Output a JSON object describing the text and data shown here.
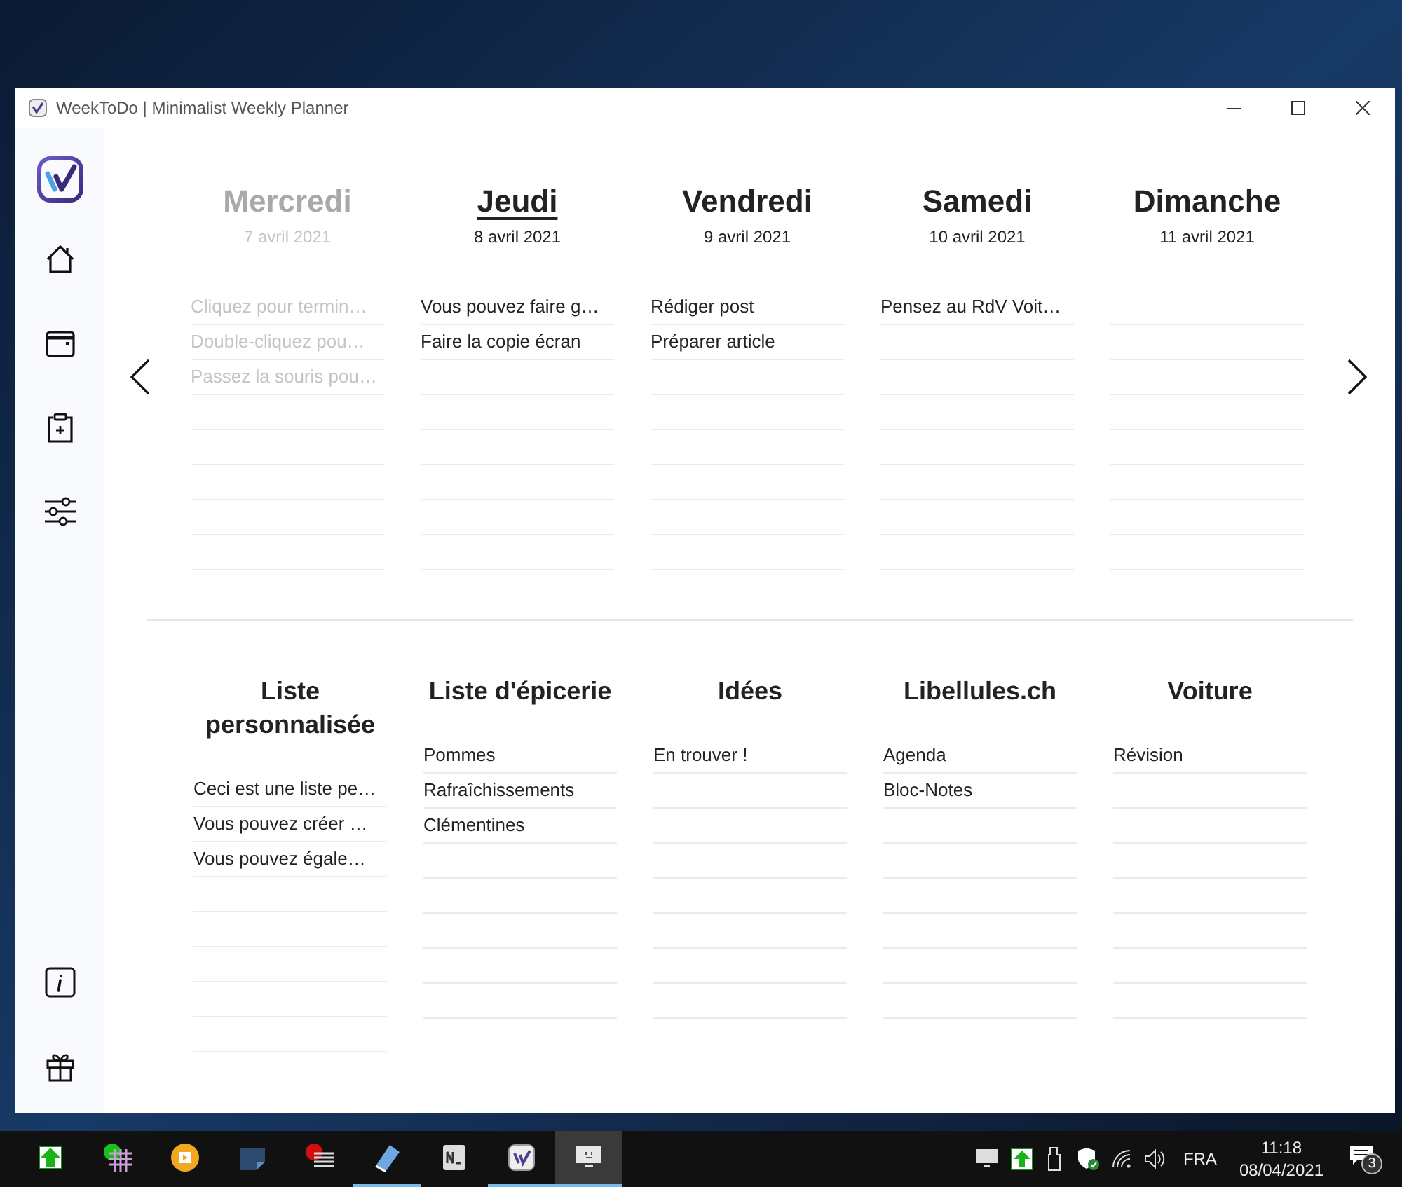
{
  "window": {
    "title": "WeekToDo | Minimalist Weekly Planner"
  },
  "days": [
    {
      "name": "Mercredi",
      "date": "7 avril 2021",
      "past": true,
      "today": false,
      "tasks": [
        "Cliquez pour termin…",
        "Double-cliquez pou…",
        "Passez la souris pou…"
      ]
    },
    {
      "name": "Jeudi",
      "date": "8 avril 2021",
      "past": false,
      "today": true,
      "tasks": [
        "Vous pouvez faire g…",
        "Faire la copie écran"
      ]
    },
    {
      "name": "Vendredi",
      "date": "9 avril 2021",
      "past": false,
      "today": false,
      "tasks": [
        "Rédiger post",
        "Préparer article"
      ]
    },
    {
      "name": "Samedi",
      "date": "10 avril 2021",
      "past": false,
      "today": false,
      "tasks": [
        "Pensez au RdV Voit…"
      ]
    },
    {
      "name": "Dimanche",
      "date": "11 avril 2021",
      "past": false,
      "today": false
    }
  ],
  "lists": [
    {
      "name": "Liste personnalisée",
      "tasks": [
        "Ceci est une liste pe…",
        "Vous pouvez créer …",
        "Vous pouvez égale…"
      ]
    },
    {
      "name": "Liste d'épicerie",
      "tasks": [
        "Pommes",
        "Rafraîchissements",
        "Clémentines"
      ]
    },
    {
      "name": "Idées",
      "tasks": [
        "En trouver !"
      ]
    },
    {
      "name": "Libellules.ch",
      "tasks": [
        "Agenda",
        "Bloc-Notes"
      ]
    },
    {
      "name": "Voiture",
      "tasks": [
        "Révision"
      ]
    }
  ],
  "taskbar": {
    "apps": [
      {
        "kind": "upload",
        "running": false,
        "active": false
      },
      {
        "kind": "grid",
        "running": false,
        "active": false
      },
      {
        "kind": "player",
        "running": false,
        "active": false
      },
      {
        "kind": "note",
        "running": false,
        "active": false
      },
      {
        "kind": "list",
        "running": false,
        "active": false
      },
      {
        "kind": "notepad",
        "running": true,
        "active": false
      },
      {
        "kind": "terminal",
        "running": false,
        "active": false
      },
      {
        "kind": "weektodo",
        "running": true,
        "active": false
      },
      {
        "kind": "monitor",
        "running": true,
        "active": true
      }
    ],
    "language": "FRA",
    "time": "11:18",
    "date": "08/04/2021",
    "notifications": "3"
  }
}
